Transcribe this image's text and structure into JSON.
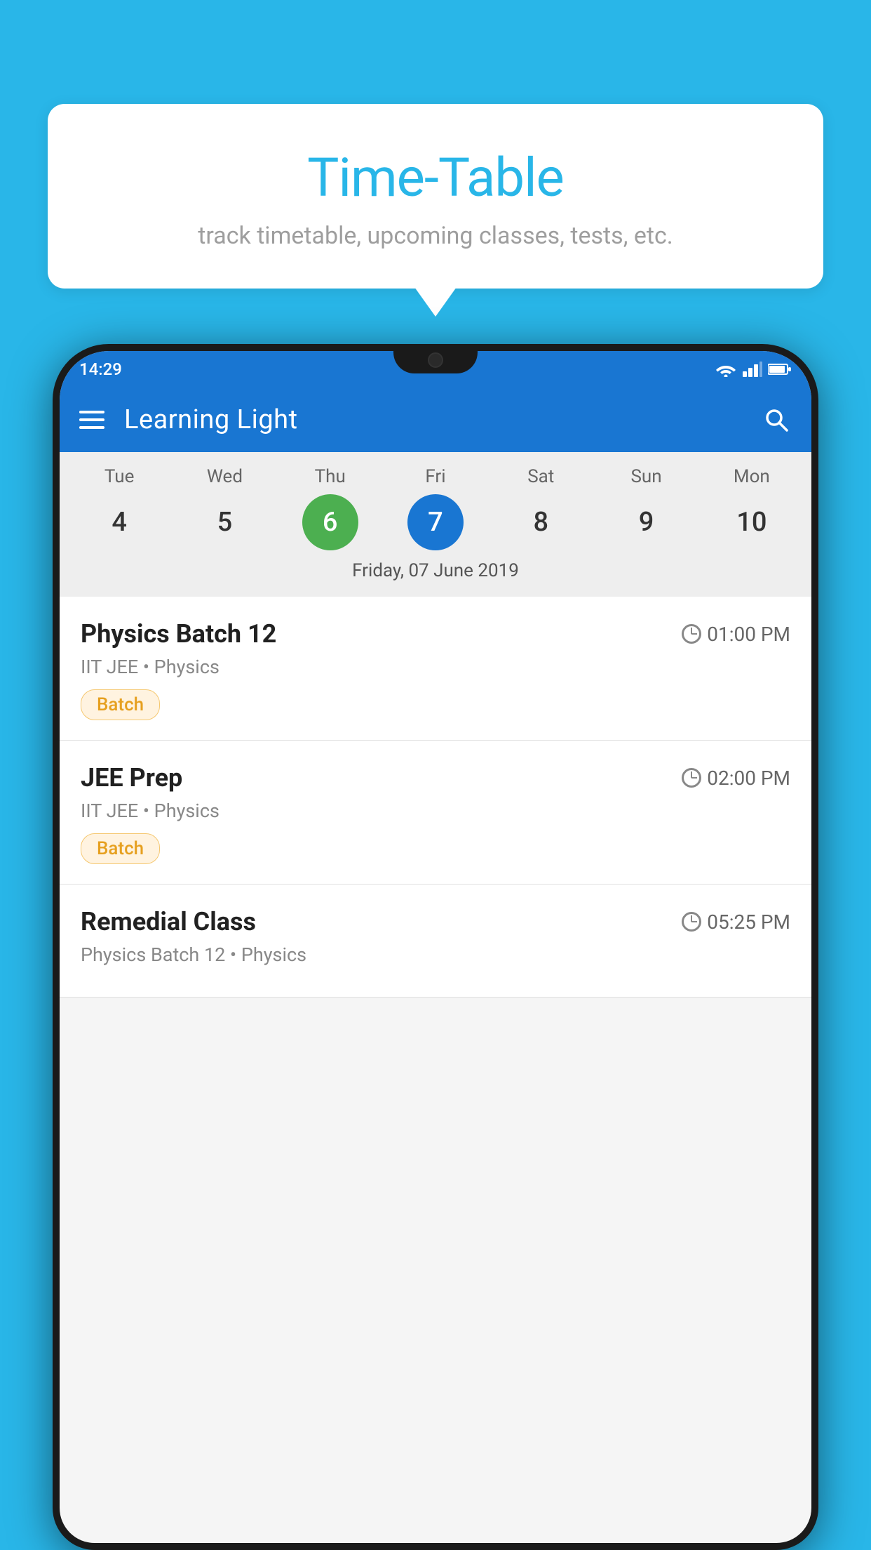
{
  "page": {
    "background_color": "#29b6e8"
  },
  "tooltip": {
    "title": "Time-Table",
    "subtitle": "track timetable, upcoming classes, tests, etc."
  },
  "status_bar": {
    "time": "14:29"
  },
  "app_bar": {
    "title": "Learning Light",
    "menu_icon_label": "hamburger-menu",
    "search_icon_label": "search"
  },
  "calendar": {
    "days": [
      {
        "label": "Tue",
        "number": "4",
        "state": "normal"
      },
      {
        "label": "Wed",
        "number": "5",
        "state": "normal"
      },
      {
        "label": "Thu",
        "number": "6",
        "state": "today"
      },
      {
        "label": "Fri",
        "number": "7",
        "state": "selected"
      },
      {
        "label": "Sat",
        "number": "8",
        "state": "normal"
      },
      {
        "label": "Sun",
        "number": "9",
        "state": "normal"
      },
      {
        "label": "Mon",
        "number": "10",
        "state": "normal"
      }
    ],
    "selected_date_label": "Friday, 07 June 2019"
  },
  "schedule": {
    "items": [
      {
        "title": "Physics Batch 12",
        "time": "01:00 PM",
        "subtitle": "IIT JEE • Physics",
        "badge": "Batch"
      },
      {
        "title": "JEE Prep",
        "time": "02:00 PM",
        "subtitle": "IIT JEE • Physics",
        "badge": "Batch"
      },
      {
        "title": "Remedial Class",
        "time": "05:25 PM",
        "subtitle": "Physics Batch 12 • Physics",
        "badge": ""
      }
    ]
  }
}
